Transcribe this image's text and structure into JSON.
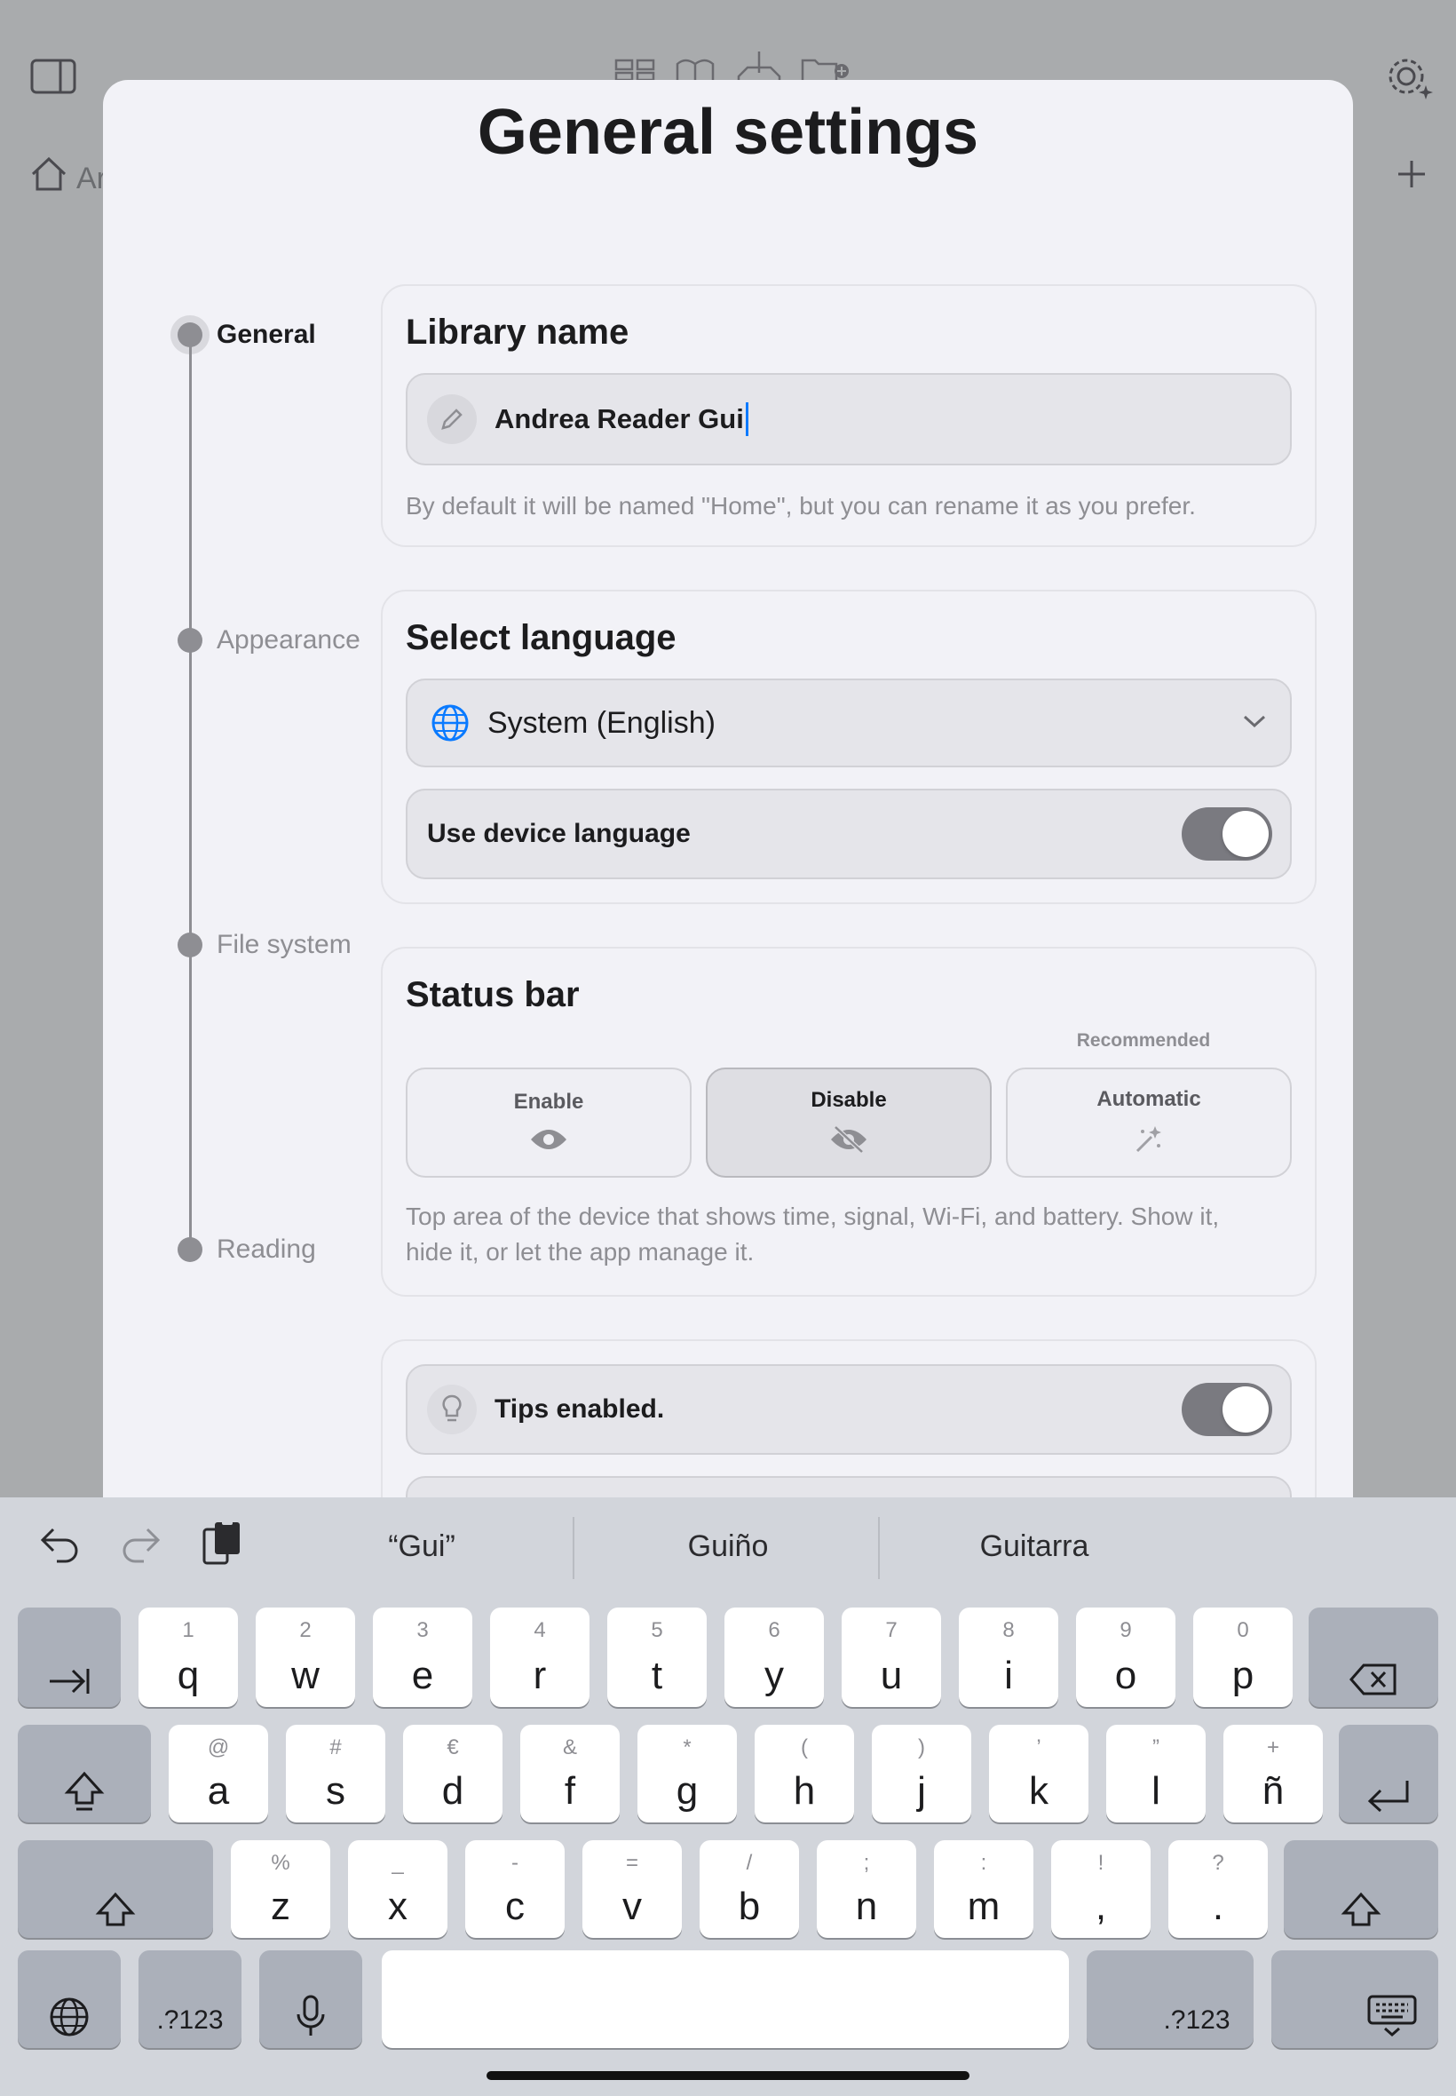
{
  "background": {
    "home_label": "Ar"
  },
  "sheet": {
    "title": "General settings"
  },
  "stepper": {
    "steps": [
      {
        "label": "General",
        "active": true
      },
      {
        "label": "Appearance",
        "active": false
      },
      {
        "label": "File system",
        "active": false
      },
      {
        "label": "Reading",
        "active": false
      }
    ]
  },
  "library_card": {
    "title": "Library name",
    "input_value": "Andrea Reader Gui",
    "hint": "By default it will be named \"Home\", but you can rename it as you prefer."
  },
  "language_card": {
    "title": "Select language",
    "selected": "System (English)",
    "device_toggle_label": "Use device language",
    "device_toggle_on": true
  },
  "status_bar_card": {
    "title": "Status bar",
    "recommended_label": "Recommended",
    "options": [
      {
        "label": "Enable",
        "icon": "eye-icon",
        "selected": false
      },
      {
        "label": "Disable",
        "icon": "eye-slash-icon",
        "selected": true
      },
      {
        "label": "Automatic",
        "icon": "magic-wand-icon",
        "selected": false
      }
    ],
    "hint_line1": "Top area of the device that shows time, signal, Wi-Fi, and battery. Show it,",
    "hint_line2": "hide it, or let the app manage it."
  },
  "tips_card": {
    "tips_label": "Tips enabled.",
    "tips_on": true
  },
  "keyboard": {
    "suggestions": [
      "“Gui”",
      "Guiño",
      "Guitarra"
    ],
    "row1": [
      {
        "main": "q",
        "sub": "1"
      },
      {
        "main": "w",
        "sub": "2"
      },
      {
        "main": "e",
        "sub": "3"
      },
      {
        "main": "r",
        "sub": "4"
      },
      {
        "main": "t",
        "sub": "5"
      },
      {
        "main": "y",
        "sub": "6"
      },
      {
        "main": "u",
        "sub": "7"
      },
      {
        "main": "i",
        "sub": "8"
      },
      {
        "main": "o",
        "sub": "9"
      },
      {
        "main": "p",
        "sub": "0"
      }
    ],
    "row2": [
      {
        "main": "a",
        "sub": "@"
      },
      {
        "main": "s",
        "sub": "#"
      },
      {
        "main": "d",
        "sub": "€"
      },
      {
        "main": "f",
        "sub": "&"
      },
      {
        "main": "g",
        "sub": "*"
      },
      {
        "main": "h",
        "sub": "("
      },
      {
        "main": "j",
        "sub": ")"
      },
      {
        "main": "k",
        "sub": "’"
      },
      {
        "main": "l",
        "sub": "”"
      },
      {
        "main": "ñ",
        "sub": "+"
      }
    ],
    "row3": [
      {
        "main": "z",
        "sub": "%"
      },
      {
        "main": "x",
        "sub": "_"
      },
      {
        "main": "c",
        "sub": "-"
      },
      {
        "main": "v",
        "sub": "="
      },
      {
        "main": "b",
        "sub": "/"
      },
      {
        "main": "n",
        "sub": ";"
      },
      {
        "main": "m",
        "sub": ":"
      },
      {
        "main": ",",
        "sub": "!"
      },
      {
        "main": ".",
        "sub": "?"
      }
    ],
    "numbers_key_left": ".?123",
    "numbers_key_right": ".?123"
  },
  "colors": {
    "accent": "#0a7aff",
    "toggle_on": "#7a7a80"
  }
}
